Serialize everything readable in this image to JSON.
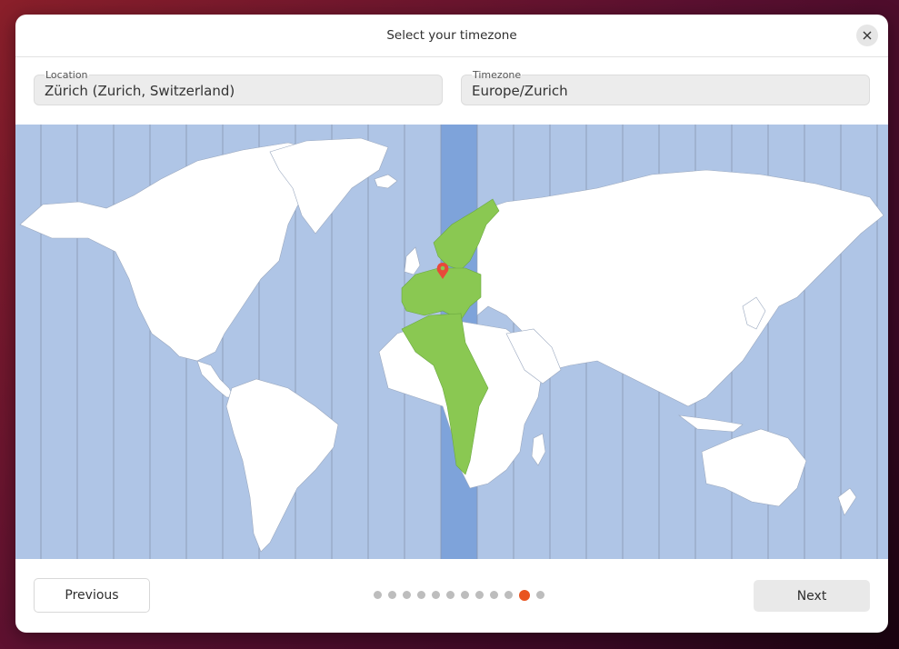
{
  "dialog": {
    "title": "Select your timezone",
    "close_icon": "close-icon"
  },
  "fields": {
    "location": {
      "label": "Location",
      "value": "Zürich (Zurich, Switzerland)"
    },
    "timezone": {
      "label": "Timezone",
      "value": "Europe/Zurich"
    }
  },
  "map": {
    "selected_timezone": "Europe/Zurich",
    "marker_icon": "map-pin-icon",
    "colors": {
      "ocean": "#afc5e6",
      "land": "#ffffff",
      "highlight_band": "#7ea3da",
      "selected_zone": "#8ac852",
      "marker": "#e8493a"
    }
  },
  "footer": {
    "previous_label": "Previous",
    "next_label": "Next",
    "steps_total": 12,
    "step_current": 11,
    "accent": "#e95420"
  }
}
